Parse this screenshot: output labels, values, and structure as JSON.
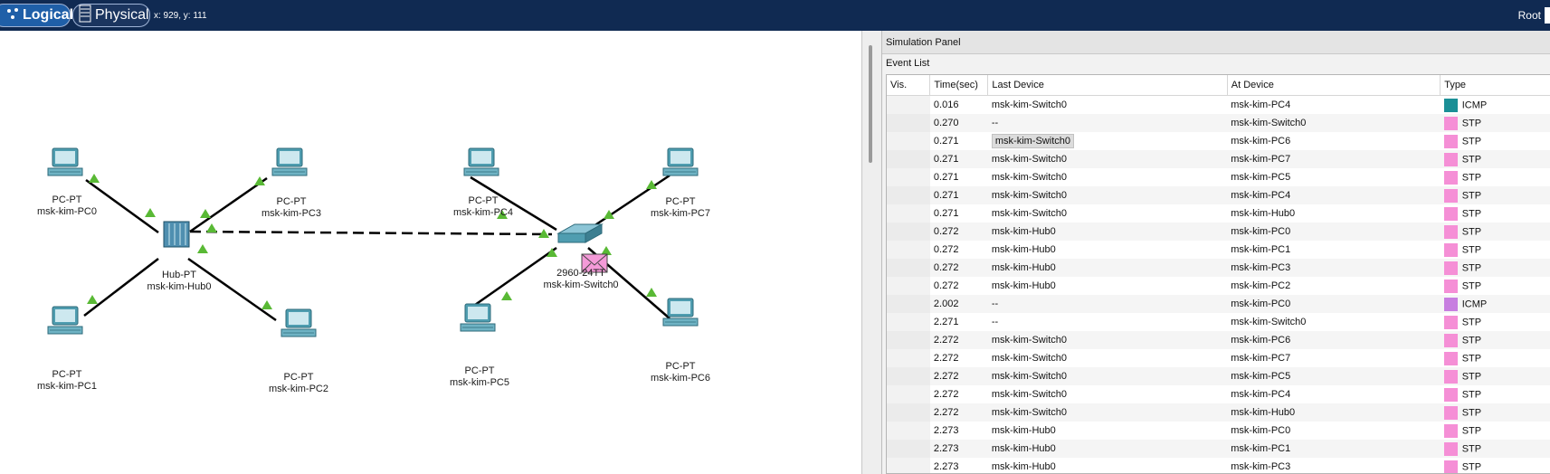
{
  "toolbar": {
    "logical_label": "Logical",
    "physical_label": "Physical",
    "coordinates": "x: 929, y: 111",
    "root_label": "Root"
  },
  "topology": {
    "devices": [
      {
        "type": "PC-PT",
        "name": "msk-kim-PC0"
      },
      {
        "type": "PC-PT",
        "name": "msk-kim-PC1"
      },
      {
        "type": "PC-PT",
        "name": "msk-kim-PC2"
      },
      {
        "type": "PC-PT",
        "name": "msk-kim-PC3"
      },
      {
        "type": "Hub-PT",
        "name": "msk-kim-Hub0"
      },
      {
        "type": "PC-PT",
        "name": "msk-kim-PC4"
      },
      {
        "type": "PC-PT",
        "name": "msk-kim-PC5"
      },
      {
        "type": "PC-PT",
        "name": "msk-kim-PC6"
      },
      {
        "type": "PC-PT",
        "name": "msk-kim-PC7"
      },
      {
        "type": "2960-24TT",
        "name": "msk-kim-Switch0"
      }
    ],
    "colors": {
      "link": "#000000",
      "port_up": "#59b935",
      "pdu_envelope": "#f49ad8"
    }
  },
  "simulation_panel": {
    "title": "Simulation Panel",
    "event_list_title": "Event List",
    "columns": [
      "Vis.",
      "Time(sec)",
      "Last Device",
      "At Device",
      "Type"
    ],
    "type_colors": {
      "ICMP_a": "#1a8f96",
      "STP": "#f58fd6",
      "ICMP_b": "#c77ee0"
    },
    "events": [
      {
        "time": "0.016",
        "last": "msk-kim-Switch0",
        "at": "msk-kim-PC4",
        "type": "ICMP",
        "color": "#1a8f96"
      },
      {
        "time": "0.270",
        "last": "--",
        "at": "msk-kim-Switch0",
        "type": "STP",
        "color": "#f58fd6"
      },
      {
        "time": "0.271",
        "last": "msk-kim-Switch0",
        "at": "msk-kim-PC6",
        "type": "STP",
        "color": "#f58fd6"
      },
      {
        "time": "0.271",
        "last": "msk-kim-Switch0",
        "at": "msk-kim-PC7",
        "type": "STP",
        "color": "#f58fd6"
      },
      {
        "time": "0.271",
        "last": "msk-kim-Switch0",
        "at": "msk-kim-PC5",
        "type": "STP",
        "color": "#f58fd6"
      },
      {
        "time": "0.271",
        "last": "msk-kim-Switch0",
        "at": "msk-kim-PC4",
        "type": "STP",
        "color": "#f58fd6"
      },
      {
        "time": "0.271",
        "last": "msk-kim-Switch0",
        "at": "msk-kim-Hub0",
        "type": "STP",
        "color": "#f58fd6"
      },
      {
        "time": "0.272",
        "last": "msk-kim-Hub0",
        "at": "msk-kim-PC0",
        "type": "STP",
        "color": "#f58fd6"
      },
      {
        "time": "0.272",
        "last": "msk-kim-Hub0",
        "at": "msk-kim-PC1",
        "type": "STP",
        "color": "#f58fd6"
      },
      {
        "time": "0.272",
        "last": "msk-kim-Hub0",
        "at": "msk-kim-PC3",
        "type": "STP",
        "color": "#f58fd6"
      },
      {
        "time": "0.272",
        "last": "msk-kim-Hub0",
        "at": "msk-kim-PC2",
        "type": "STP",
        "color": "#f58fd6"
      },
      {
        "time": "2.002",
        "last": "--",
        "at": "msk-kim-PC0",
        "type": "ICMP",
        "color": "#c77ee0"
      },
      {
        "time": "2.271",
        "last": "--",
        "at": "msk-kim-Switch0",
        "type": "STP",
        "color": "#f58fd6"
      },
      {
        "time": "2.272",
        "last": "msk-kim-Switch0",
        "at": "msk-kim-PC6",
        "type": "STP",
        "color": "#f58fd6"
      },
      {
        "time": "2.272",
        "last": "msk-kim-Switch0",
        "at": "msk-kim-PC7",
        "type": "STP",
        "color": "#f58fd6"
      },
      {
        "time": "2.272",
        "last": "msk-kim-Switch0",
        "at": "msk-kim-PC5",
        "type": "STP",
        "color": "#f58fd6"
      },
      {
        "time": "2.272",
        "last": "msk-kim-Switch0",
        "at": "msk-kim-PC4",
        "type": "STP",
        "color": "#f58fd6"
      },
      {
        "time": "2.272",
        "last": "msk-kim-Switch0",
        "at": "msk-kim-Hub0",
        "type": "STP",
        "color": "#f58fd6"
      },
      {
        "time": "2.273",
        "last": "msk-kim-Hub0",
        "at": "msk-kim-PC0",
        "type": "STP",
        "color": "#f58fd6"
      },
      {
        "time": "2.273",
        "last": "msk-kim-Hub0",
        "at": "msk-kim-PC1",
        "type": "STP",
        "color": "#f58fd6"
      },
      {
        "time": "2.273",
        "last": "msk-kim-Hub0",
        "at": "msk-kim-PC3",
        "type": "STP",
        "color": "#f58fd6"
      }
    ]
  }
}
